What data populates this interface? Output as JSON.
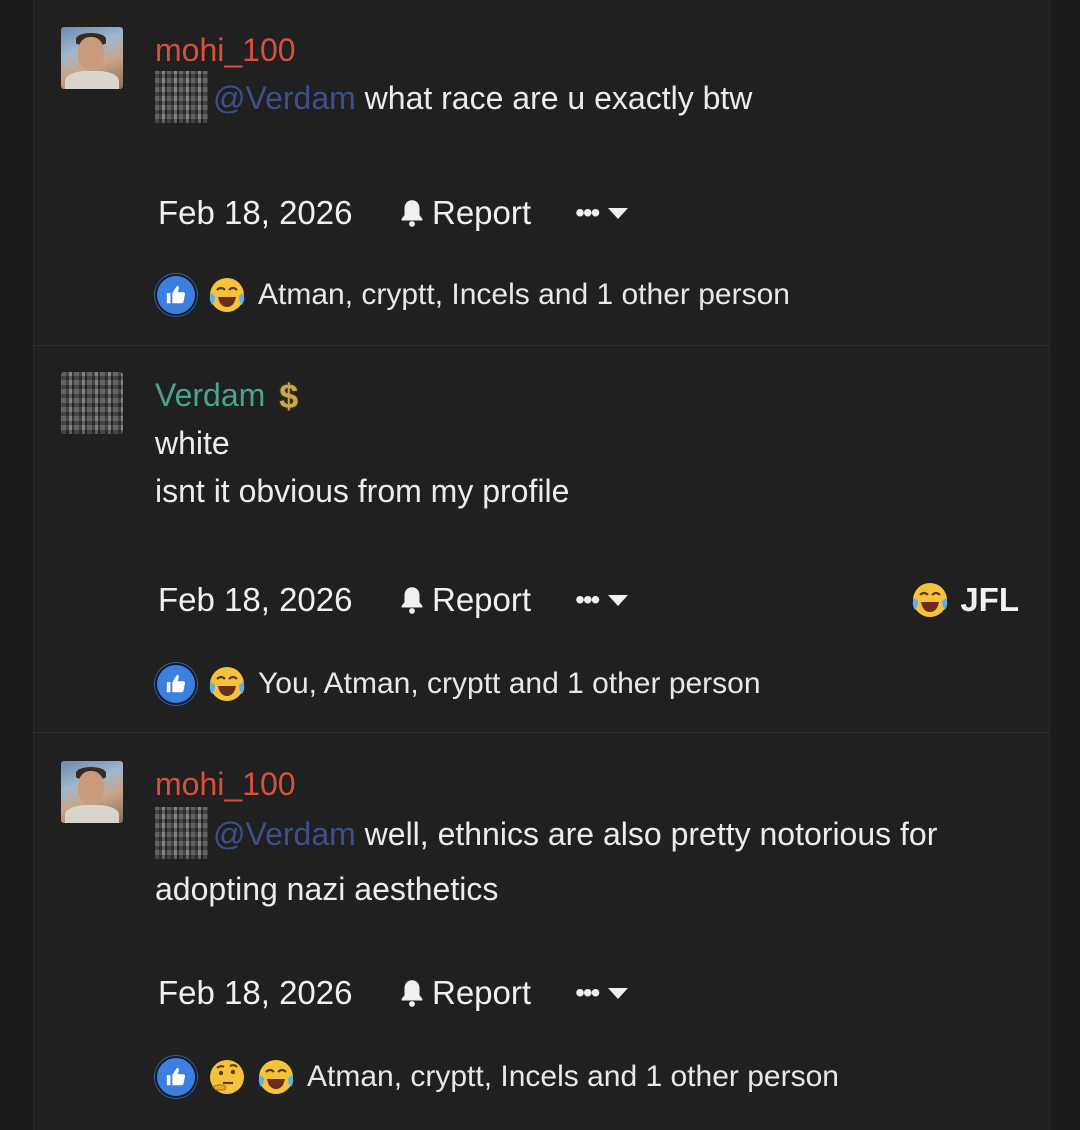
{
  "posts": [
    {
      "username": "mohi_100",
      "mention": "@Verdam",
      "message_lines": [
        "what race are u exactly btw"
      ],
      "date": "Feb 18, 2026",
      "report_label": "Report",
      "more_label": "•••",
      "reaction_icons": [
        "like-icon",
        "crying-laughing-icon"
      ],
      "reaction_text": "Atman, cryptt, Incels and 1 other person"
    },
    {
      "username": "Verdam",
      "badge": "$",
      "message_lines": [
        "white",
        "isnt it obvious from my profile"
      ],
      "date": "Feb 18, 2026",
      "report_label": "Report",
      "more_label": "•••",
      "jfl_label": "JFL",
      "reaction_icons": [
        "like-icon",
        "crying-laughing-icon"
      ],
      "reaction_text": "You, Atman, cryptt and 1 other person"
    },
    {
      "username": "mohi_100",
      "mention": "@Verdam",
      "message_lines": [
        "well, ethnics are also pretty notorious for",
        "adopting nazi aesthetics"
      ],
      "date": "Feb 18, 2026",
      "report_label": "Report",
      "more_label": "•••",
      "reaction_icons": [
        "like-icon",
        "thinking-face-icon",
        "crying-laughing-icon"
      ],
      "reaction_text": "Atman, cryptt, Incels and 1 other person"
    }
  ],
  "colors": {
    "background": "#202020",
    "username_red": "#d94f3d",
    "username_teal": "#4aa38f",
    "mention": "#3e4f8a",
    "like_blue": "#3b7fe0"
  }
}
